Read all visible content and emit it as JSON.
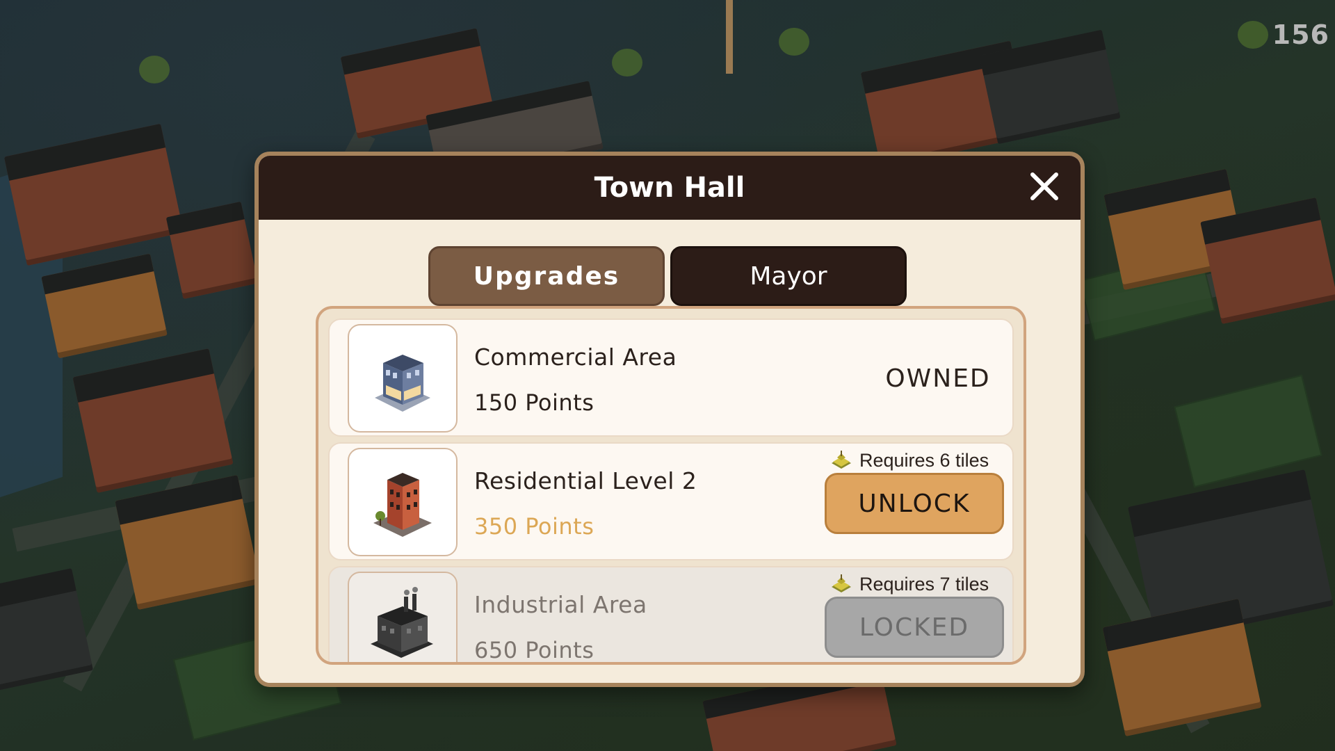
{
  "hud": {
    "counter": "156"
  },
  "dialog": {
    "title": "Town Hall",
    "close_icon": "close-icon",
    "tabs": [
      {
        "label": "Upgrades",
        "active": true
      },
      {
        "label": "Mayor",
        "active": false
      }
    ],
    "items": [
      {
        "name": "Commercial Area",
        "points": "150 Points",
        "status": "OWNED",
        "icon": "commercial-building-icon"
      },
      {
        "name": "Residential Level 2",
        "points": "350 Points",
        "requirement": "Requires 6 tiles",
        "action": "UNLOCK",
        "icon": "residential-building-icon"
      },
      {
        "name": "Industrial Area",
        "points": "650 Points",
        "requirement": "Requires 7 tiles",
        "action": "LOCKED",
        "icon": "industrial-building-icon"
      }
    ]
  },
  "colors": {
    "header_bg": "#2c1c17",
    "panel_bg": "#f5ecdc",
    "tab_active": "#7b5c44",
    "unlock_button": "#dfa45f",
    "locked_button": "#a7a7a7",
    "affordable_points": "#dca755"
  }
}
